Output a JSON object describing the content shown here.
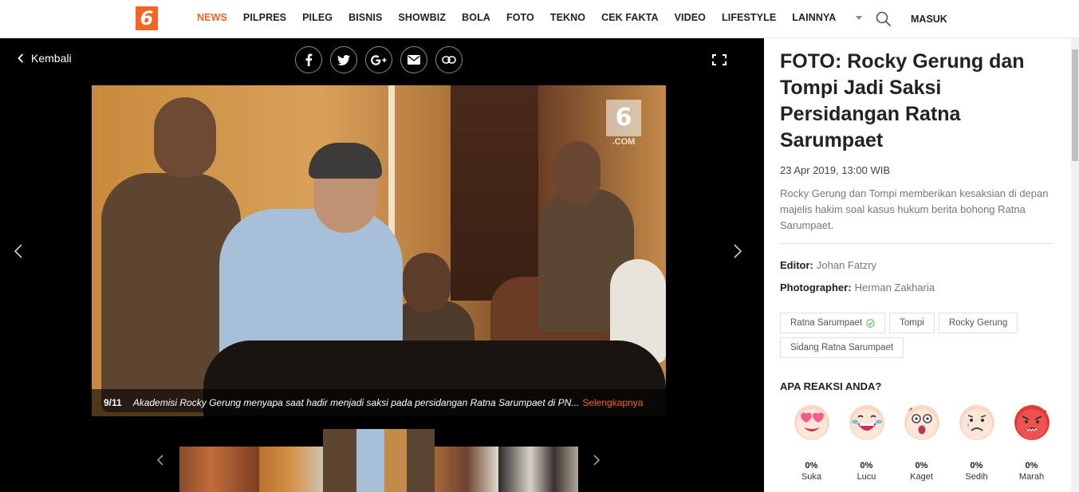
{
  "header": {
    "logo_text": "6",
    "nav": [
      "NEWS",
      "PILPRES",
      "PILEG",
      "BISNIS",
      "SHOWBIZ",
      "BOLA",
      "FOTO",
      "TEKNO",
      "CEK FAKTA",
      "VIDEO",
      "LIFESTYLE",
      "LAINNYA"
    ],
    "active_nav": "NEWS",
    "login_label": "MASUK",
    "accent_color": "#f26522"
  },
  "gallery": {
    "back_label": "Kembali",
    "share_icons": [
      "facebook-icon",
      "twitter-icon",
      "google-plus-icon",
      "email-icon",
      "link-icon"
    ],
    "watermark_text": ".COM",
    "caption_counter": "9/11",
    "caption_text": "Akademisi Rocky Gerung menyapa saat hadir menjadi saksi pada persidangan Ratna Sarumpaet di PN...",
    "caption_more": "Selengkapnya"
  },
  "article": {
    "title": "FOTO: Rocky Gerung dan Tompi Jadi Saksi Persidangan Ratna Sarumpaet",
    "date": "23 Apr 2019, 13:00 WIB",
    "summary": "Rocky Gerung dan Tompi memberikan kesaksian di depan majelis hakim soal kasus hukum berita bohong Ratna Sarumpaet.",
    "editor_label": "Editor:",
    "editor": "Johan Fatzry",
    "photographer_label": "Photographer:",
    "photographer": "Herman Zakharia",
    "tags": [
      "Ratna Sarumpaet",
      "Tompi",
      "Rocky Gerung",
      "Sidang Ratna Sarumpaet"
    ]
  },
  "reactions": {
    "title": "APA REAKSI ANDA?",
    "items": [
      {
        "label": "Suka",
        "pct": "0%"
      },
      {
        "label": "Lucu",
        "pct": "0%"
      },
      {
        "label": "Kaget",
        "pct": "0%"
      },
      {
        "label": "Sedih",
        "pct": "0%"
      },
      {
        "label": "Marah",
        "pct": "0%"
      }
    ]
  }
}
